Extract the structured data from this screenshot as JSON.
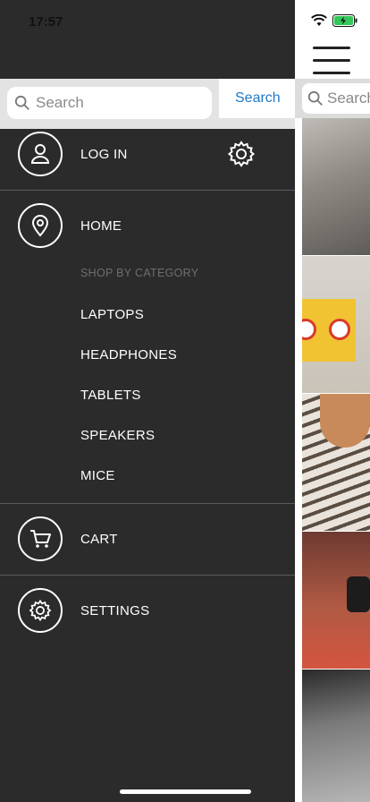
{
  "status": {
    "time": "17:57"
  },
  "drawer": {
    "search": {
      "placeholder": "Search",
      "button_label": "Search"
    },
    "login_label": "LOG IN",
    "home_label": "HOME",
    "category_header": "SHOP BY CATEGORY",
    "categories": [
      "LAPTOPS",
      "HEADPHONES",
      "TABLETS",
      "SPEAKERS",
      "MICE"
    ],
    "cart_label": "CART",
    "settings_label": "SETTINGS"
  },
  "main": {
    "search_placeholder": "Search"
  },
  "colors": {
    "drawer_bg": "#2b2b2b",
    "accent": "#1f79c9",
    "divider": "#5b5b5b",
    "battery": "#34c759"
  }
}
